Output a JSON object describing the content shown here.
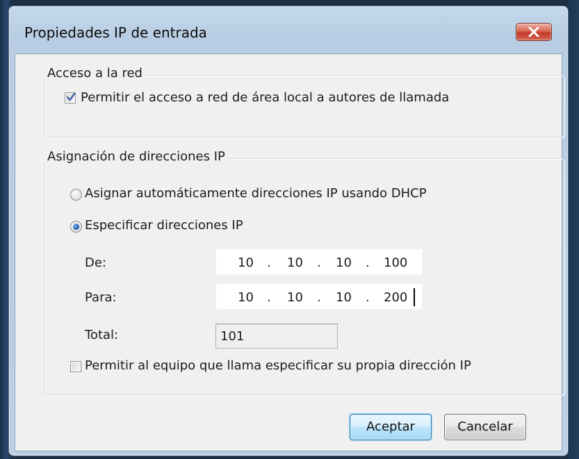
{
  "dialog": {
    "title": "Propiedades IP de entrada"
  },
  "network_access": {
    "legend": "Acceso a la red",
    "allow_lan_label": "Permitir el acceso a red de área local a autores de llamada",
    "allow_lan_checked": true
  },
  "ip_assignment": {
    "legend": "Asignación de direcciones IP",
    "dhcp_label": "Asignar automáticamente direcciones IP usando DHCP",
    "dhcp_selected": false,
    "specify_label": "Especificar direcciones IP",
    "specify_selected": true,
    "from_label": "De:",
    "from_ip": [
      "10",
      "10",
      "10",
      "100"
    ],
    "to_label": "Para:",
    "to_ip": [
      "10",
      "10",
      "10",
      "200"
    ],
    "total_label": "Total:",
    "total_value": "101",
    "caller_ip_label": "Permitir al equipo que llama especificar su propia dirección IP",
    "caller_ip_checked": false
  },
  "buttons": {
    "ok": "Aceptar",
    "cancel": "Cancelar"
  },
  "ip_separator": "."
}
